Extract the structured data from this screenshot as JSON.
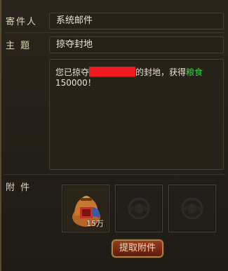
{
  "mail": {
    "sender_label": "寄件人",
    "sender_value": "系统邮件",
    "subject_label": "主 题",
    "subject_value": "掠夺封地",
    "body_prefix": "您已掠夺",
    "body_middle": "的封地，获得",
    "body_item": "粮食",
    "body_amount": "150000！",
    "attach_label": "附 件",
    "attachments": [
      {
        "icon": "grain-bag-icon",
        "quantity": "15万"
      },
      {
        "icon": "empty-slot-emblem-icon"
      },
      {
        "icon": "empty-slot-emblem-icon"
      }
    ],
    "claim_button": "提取附件"
  },
  "colors": {
    "grain_text": "#35d04c",
    "redaction": "#f11b1f",
    "button": "#9b3b21"
  }
}
